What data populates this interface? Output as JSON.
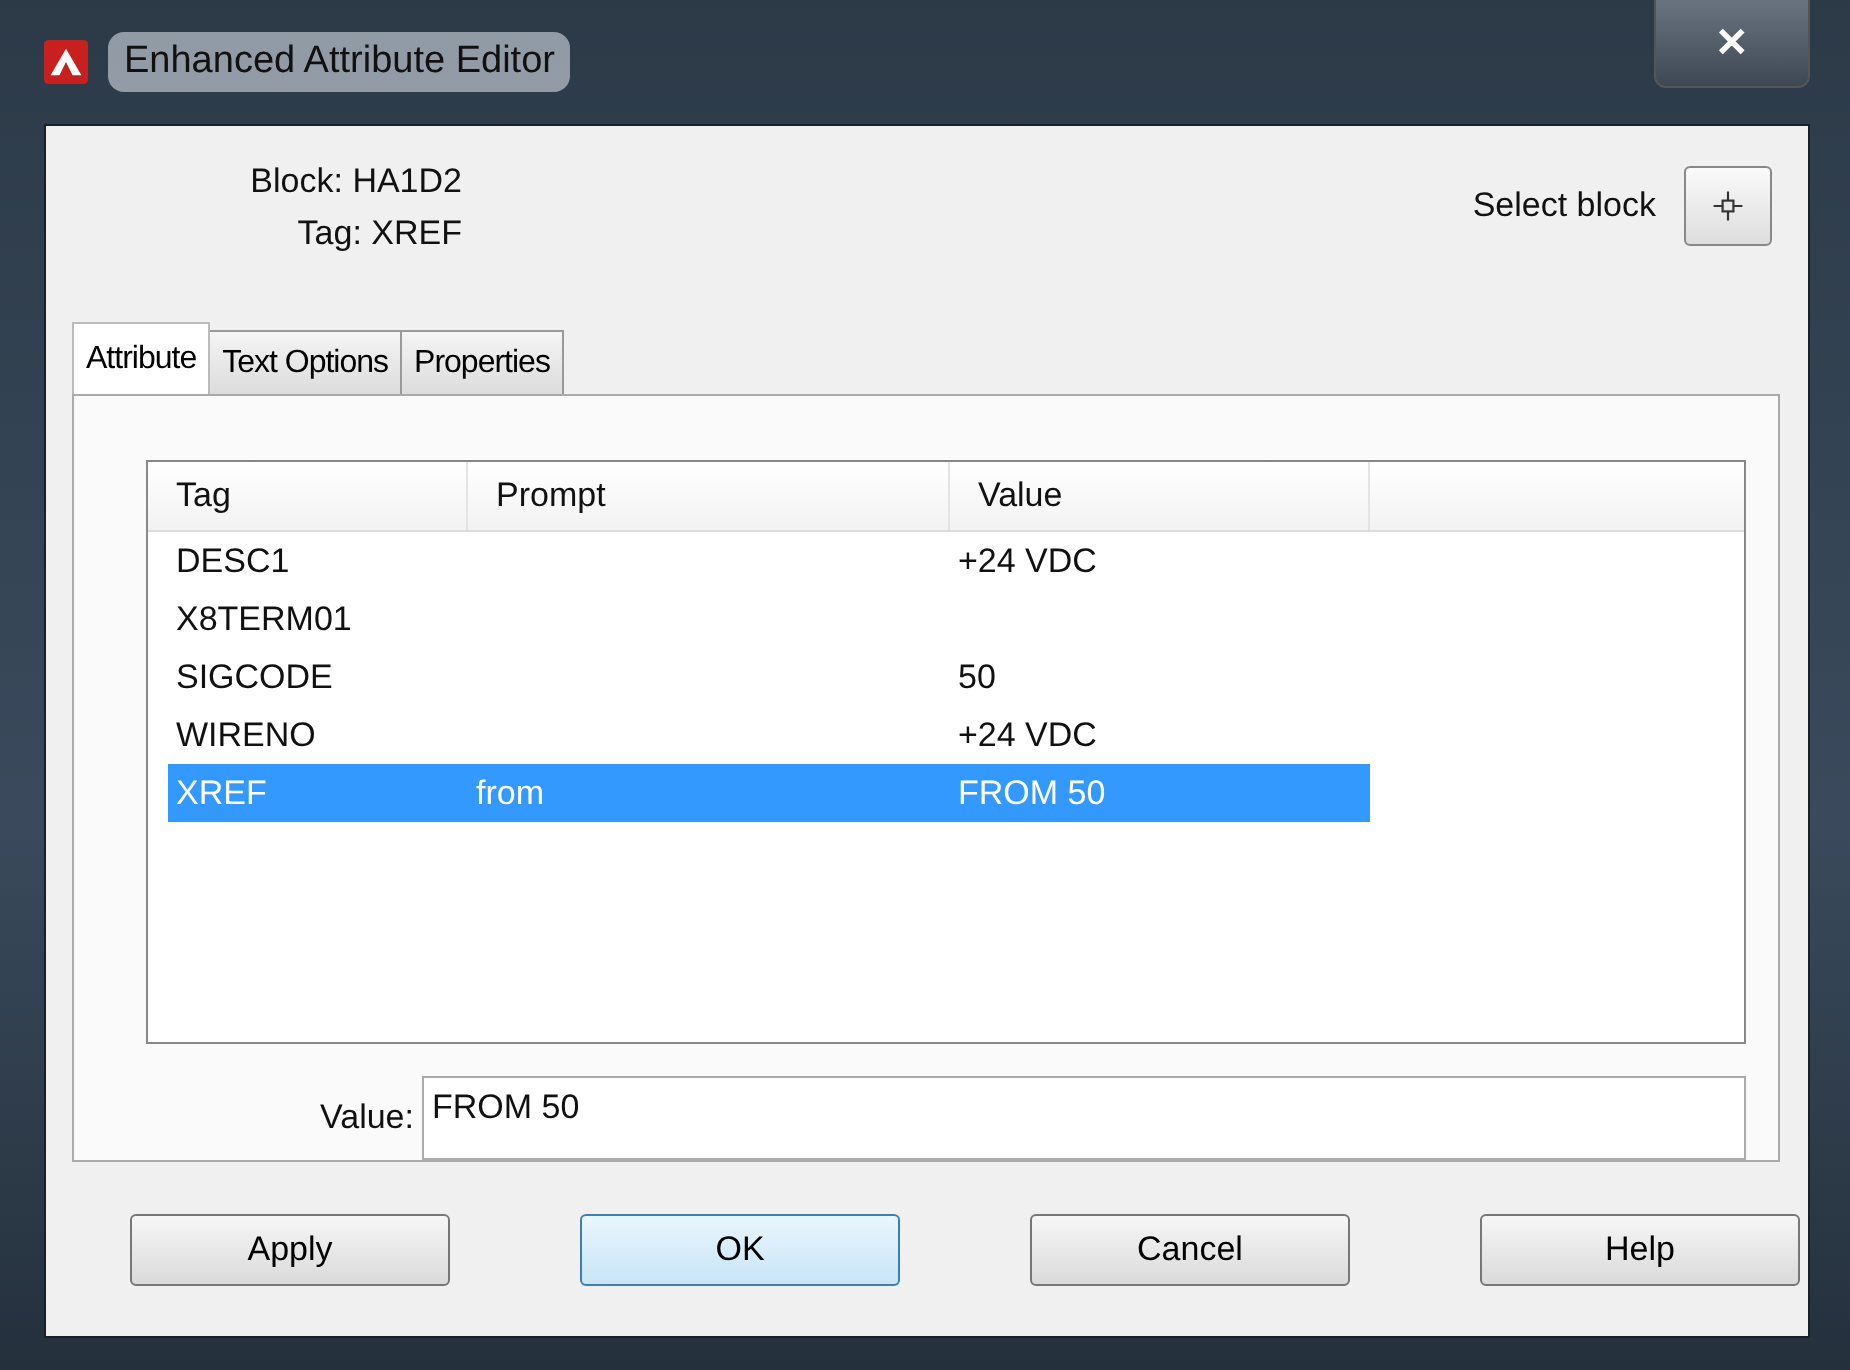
{
  "window": {
    "title": "Enhanced Attribute Editor",
    "close": "✕"
  },
  "header": {
    "block_label": "Block:",
    "block": "HA1D2",
    "tag_label": "Tag:",
    "tag": "XREF",
    "select_label": "Select block"
  },
  "tabs": [
    {
      "label": "Attribute",
      "selected": true
    },
    {
      "label": "Text Options",
      "selected": false
    },
    {
      "label": "Properties",
      "selected": false
    }
  ],
  "table": {
    "columns": [
      "Tag",
      "Prompt",
      "Value"
    ],
    "rows": [
      {
        "tag": "DESC1",
        "prompt": "",
        "value": "+24 VDC",
        "selected": false
      },
      {
        "tag": "X8TERM01",
        "prompt": "",
        "value": "",
        "selected": false
      },
      {
        "tag": "SIGCODE",
        "prompt": "",
        "value": "50",
        "selected": false
      },
      {
        "tag": "WIRENO",
        "prompt": "",
        "value": "+24 VDC",
        "selected": false
      },
      {
        "tag": "XREF",
        "prompt": "from",
        "value": "FROM 50",
        "selected": true
      }
    ]
  },
  "value_field": {
    "label": "Value:",
    "value": "FROM 50"
  },
  "buttons": [
    {
      "label": "Apply",
      "default": false
    },
    {
      "label": "OK",
      "default": true
    },
    {
      "label": "Cancel",
      "default": false
    },
    {
      "label": "Help",
      "default": false
    }
  ]
}
